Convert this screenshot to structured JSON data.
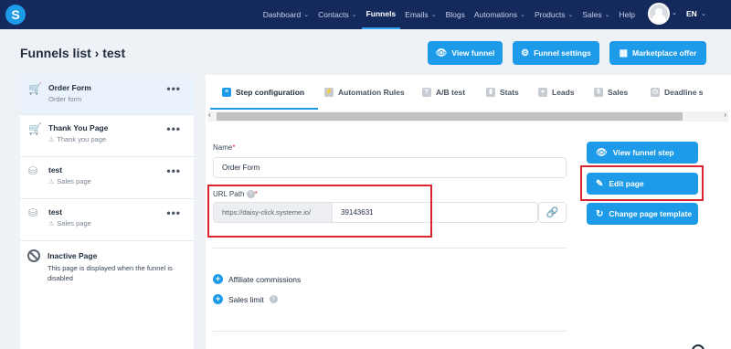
{
  "nav": {
    "logo": "S",
    "links": [
      "Dashboard",
      "Contacts",
      "Funnels",
      "Emails",
      "Blogs",
      "Automations",
      "Products",
      "Sales",
      "Help"
    ],
    "links_with_chevron": [
      true,
      true,
      false,
      true,
      false,
      true,
      true,
      true,
      false
    ],
    "active": "Funnels",
    "language": "EN"
  },
  "header": {
    "title": "Funnels list › test",
    "view_funnel": "View funnel",
    "funnel_settings": "Funnel settings",
    "marketplace_offer": "Marketplace offer"
  },
  "sidebar": {
    "steps": [
      {
        "title": "Order Form",
        "subtitle": "Order form",
        "warning": false
      },
      {
        "title": "Thank You Page",
        "subtitle": "Thank you page",
        "warning": true
      },
      {
        "title": "test",
        "subtitle": "Sales page",
        "warning": true
      },
      {
        "title": "test",
        "subtitle": "Sales page",
        "warning": true
      }
    ],
    "more": "•••",
    "inactive": {
      "title": "Inactive Page",
      "description": "This page is displayed when the funnel is disabled"
    }
  },
  "tabs": [
    "Step configuration",
    "Automation Rules",
    "A/B test",
    "Stats",
    "Leads",
    "Sales",
    "Deadline s"
  ],
  "tab_active": "Step configuration",
  "form": {
    "name_label": "Name",
    "name_value": "Order Form",
    "url_label": "URL Path",
    "url_prefix": "https://daisy-click.systeme.io/",
    "url_value": "39143631",
    "affiliate": "Affiliate commissions",
    "sales_limit": "Sales limit"
  },
  "side_buttons": {
    "view_step": "View funnel step",
    "edit_page": "Edit page",
    "change_template": "Change page template"
  },
  "colors": {
    "nav_bg": "#14295c",
    "accent": "#1e9be8",
    "highlight": "#d92530"
  }
}
